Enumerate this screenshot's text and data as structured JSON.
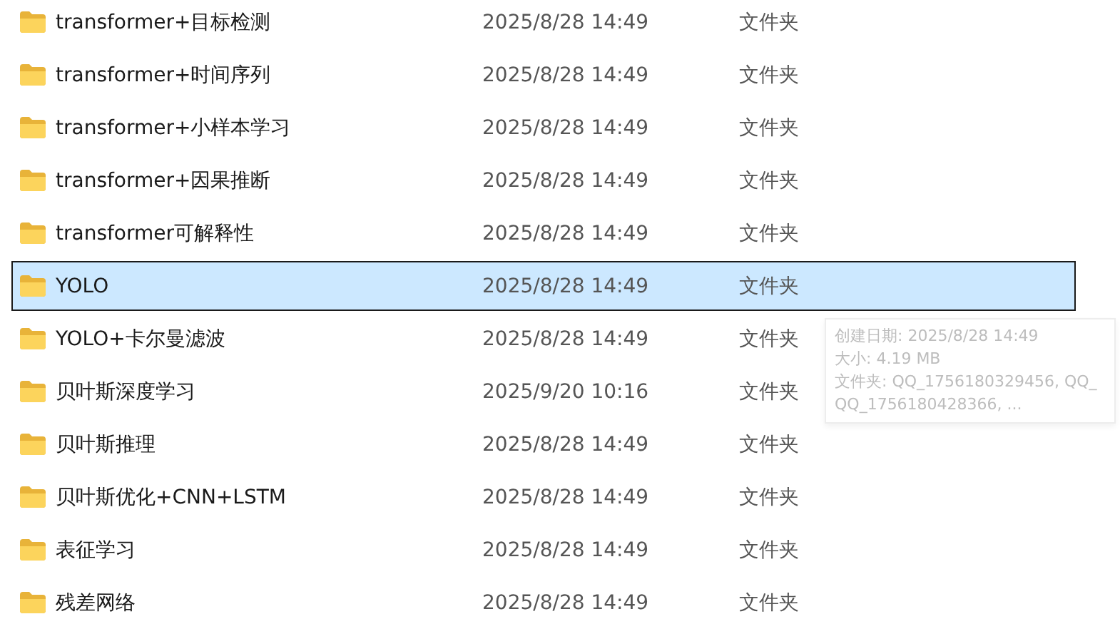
{
  "rows": [
    {
      "name": "transformer+目标检测",
      "date": "2025/8/28 14:49",
      "type": "文件夹",
      "selected": false
    },
    {
      "name": "transformer+时间序列",
      "date": "2025/8/28 14:49",
      "type": "文件夹",
      "selected": false
    },
    {
      "name": "transformer+小样本学习",
      "date": "2025/8/28 14:49",
      "type": "文件夹",
      "selected": false
    },
    {
      "name": "transformer+因果推断",
      "date": "2025/8/28 14:49",
      "type": "文件夹",
      "selected": false
    },
    {
      "name": "transformer可解释性",
      "date": "2025/8/28 14:49",
      "type": "文件夹",
      "selected": false
    },
    {
      "name": "YOLO",
      "date": "2025/8/28 14:49",
      "type": "文件夹",
      "selected": true
    },
    {
      "name": "YOLO+卡尔曼滤波",
      "date": "2025/8/28 14:49",
      "type": "文件夹",
      "selected": false
    },
    {
      "name": "贝叶斯深度学习",
      "date": "2025/9/20 10:16",
      "type": "文件夹",
      "selected": false
    },
    {
      "name": "贝叶斯推理",
      "date": "2025/8/28 14:49",
      "type": "文件夹",
      "selected": false
    },
    {
      "name": "贝叶斯优化+CNN+LSTM",
      "date": "2025/8/28 14:49",
      "type": "文件夹",
      "selected": false
    },
    {
      "name": "表征学习",
      "date": "2025/8/28 14:49",
      "type": "文件夹",
      "selected": false
    },
    {
      "name": "残差网络",
      "date": "2025/8/28 14:49",
      "type": "文件夹",
      "selected": false
    }
  ],
  "tooltip": {
    "lines": [
      "创建日期: 2025/8/28 14:49",
      "大小: 4.19 MB",
      "文件夹: QQ_1756180329456, QQ_",
      "QQ_1756180428366, ..."
    ]
  }
}
